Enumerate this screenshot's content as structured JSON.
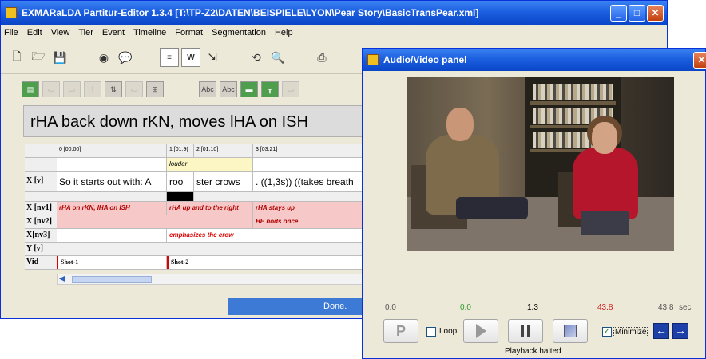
{
  "editor": {
    "title": "EXMARaLDA Partitur-Editor 1.3.4 [T:\\TP-Z2\\DATEN\\BEISPIELE\\LYON\\Pear Story\\BasicTransPear.xml]",
    "menu": [
      "File",
      "Edit",
      "View",
      "Tier",
      "Event",
      "Timeline",
      "Format",
      "Segmentation",
      "Help"
    ],
    "toolbar2_labels": [
      "Abc",
      "Abc"
    ],
    "event_display": "rHA back down rKN, moves lHA on ISH",
    "timeline": [
      "0 [00:00]",
      "1 [01.9(",
      "2 [01.10]",
      "3 [03.21]"
    ],
    "tiers": [
      {
        "label": "",
        "cells": [
          "louder"
        ]
      },
      {
        "label": "X [v]",
        "cells": [
          "So it starts out with: A",
          "roo",
          "ster crows",
          ". ((1,3s)) ((takes breath"
        ]
      },
      {
        "label": "",
        "cells": []
      },
      {
        "label": "X [nv1]",
        "cells": [
          "rHA on rKN, lHA on ISH",
          "rHA up and to the right",
          "rHA stays up"
        ]
      },
      {
        "label": "X [nv2]",
        "cells": [
          "HE nods once"
        ]
      },
      {
        "label": "X[nv3]",
        "cells": [
          "emphasizes the crow"
        ]
      },
      {
        "label": "Y [v]",
        "cells": []
      },
      {
        "label": "Vid",
        "cells": [
          "Shot-1",
          "Shot-2"
        ]
      }
    ],
    "status_text": "Done."
  },
  "av_panel": {
    "title": "Audio/Video panel",
    "times": {
      "t1": "0.0",
      "t2": "0.0",
      "t3": "1.3",
      "t4": "43.8",
      "t5": "43.8",
      "unit": "sec"
    },
    "time_colors": {
      "t2": "#2e9a2e",
      "t4": "#d42020"
    },
    "loop_label": "Loop",
    "minimize_label": "Minimize",
    "p_label": "P",
    "status": "Playback halted"
  }
}
